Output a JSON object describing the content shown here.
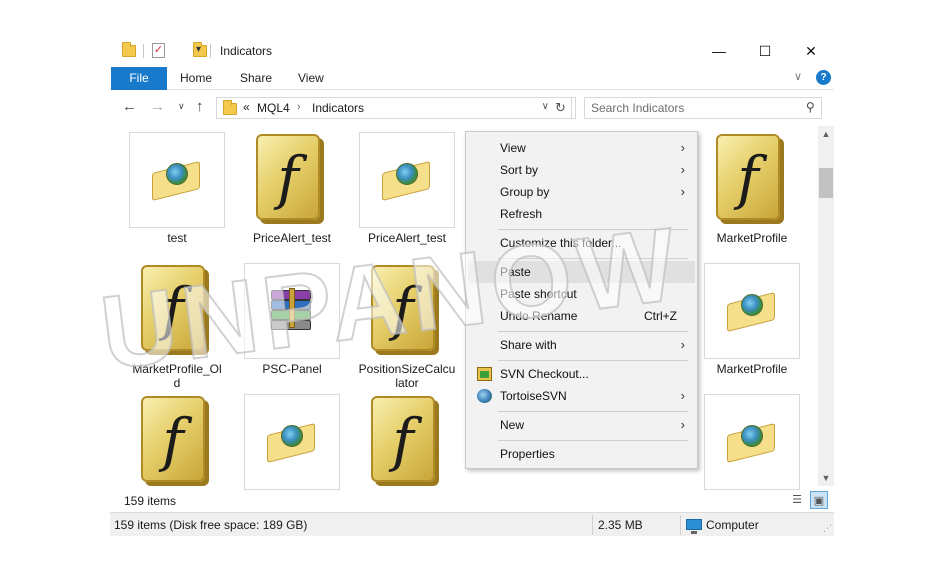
{
  "window": {
    "title": "Indicators",
    "controls": {
      "minimize": "—",
      "maximize": "☐",
      "close": "✕"
    }
  },
  "ribbon": {
    "tabs": [
      "File",
      "Home",
      "Share",
      "View"
    ],
    "help": "?"
  },
  "address": {
    "overflow": "«",
    "crumbs": [
      "MQL4",
      "Indicators"
    ],
    "separator": "›"
  },
  "search": {
    "placeholder": "Search Indicators"
  },
  "items": [
    {
      "label": "test",
      "icon": "mq4-file-icon"
    },
    {
      "label": "PriceAlert_test",
      "icon": "ex4-file-icon"
    },
    {
      "label": "PriceAlert_test",
      "icon": "mq4-file-icon"
    },
    {
      "label": "MarketProfile",
      "icon": "ex4-file-icon"
    },
    {
      "label": "MarketProfile_Ol\nd",
      "icon": "ex4-file-icon"
    },
    {
      "label": "PSC-Panel",
      "icon": "rar-archive-icon"
    },
    {
      "label": "PositionSizeCalcu\nlator",
      "icon": "ex4-file-icon"
    },
    {
      "label": "MarketProfile",
      "icon": "mq4-file-icon"
    }
  ],
  "item_count": "159 items",
  "statusbar": {
    "summary": "159 items (Disk free space: 189 GB)",
    "size": "2.35 MB",
    "location": "Computer"
  },
  "context_menu": {
    "view": "View",
    "sort_by": "Sort by",
    "group_by": "Group by",
    "refresh": "Refresh",
    "customize": "Customize this folder...",
    "paste": "Paste",
    "paste_shortcut": "Paste shortcut",
    "undo_rename": "Undo Rename",
    "undo_shortcut": "Ctrl+Z",
    "share_with": "Share with",
    "svn_checkout": "SVN Checkout...",
    "tortoise": "TortoiseSVN",
    "new": "New",
    "properties": "Properties"
  },
  "watermark": "UNPANOW",
  "colors": {
    "accent": "#1979ca",
    "menu_bg": "#f2f2f2",
    "menu_highlight": "#e0e0e0"
  }
}
